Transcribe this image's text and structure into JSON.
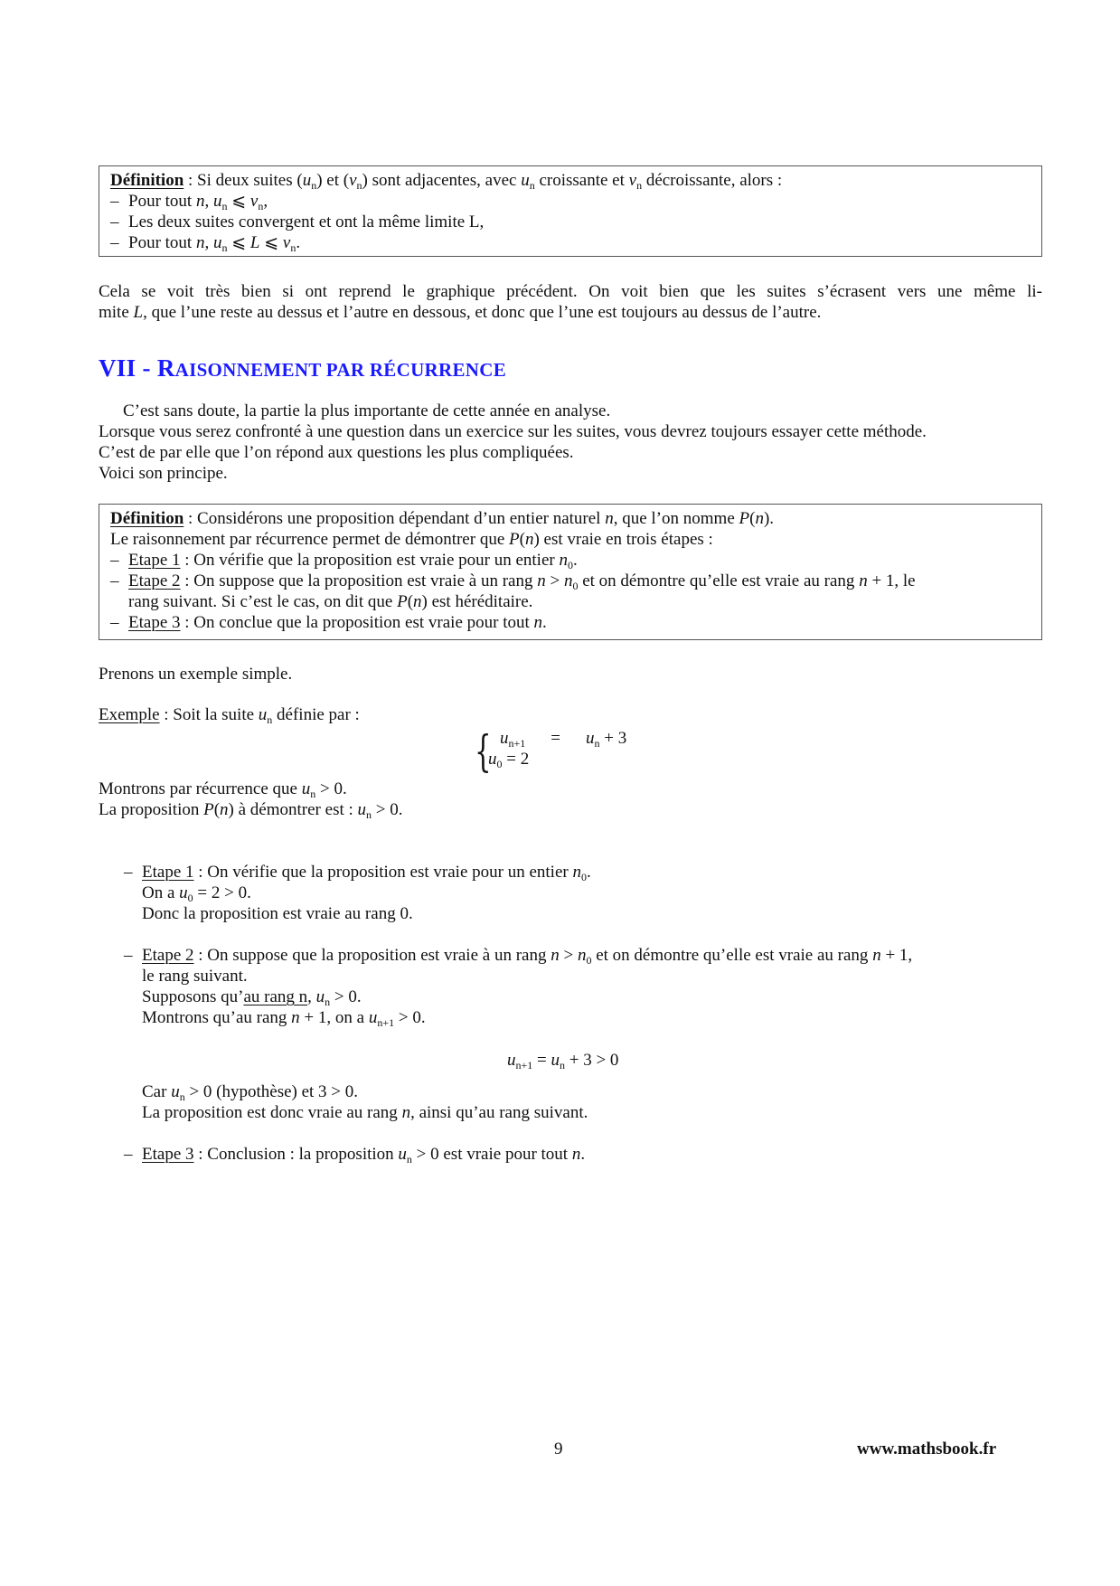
{
  "definition_box_1": {
    "label": "Définition",
    "intro": " : Si deux suites (u",
    "lines": [
      "Pour tout n, un ⩽ vn,",
      "Les deux suites convergent et ont la même limite L,",
      "Pour tout n, un ⩽ L ⩽ vn."
    ],
    "intro_full": "Si deux suites (un) et (vn) sont adjacentes, avec un croissante et vn décroissante, alors :"
  },
  "paragraph_1": {
    "line1": "Cela se voit très bien si ont reprend le graphique précédent. On voit bien que les suites s’écrasent vers une même li-",
    "line2_a": "mite ",
    "line2_b": ", que l’une reste au dessus et l’autre en dessous, et donc que l’une est toujours au dessus de l’autre."
  },
  "section": {
    "number": "VII - ",
    "title_first": "R",
    "title_rest": "AISONNEMENT PAR RÉCURRENCE"
  },
  "intro": {
    "line1": "C’est sans doute, la partie la plus importante de cette année en analyse.",
    "line2": "Lorsque vous serez confronté à une question dans un exercice sur les suites, vous devrez toujours essayer cette méthode.",
    "line3": "C’est de par elle que l’on répond aux questions les plus compliquées.",
    "line4": "Voici son principe."
  },
  "definition_box_2": {
    "label": "Définition",
    "line1_a": " : Considérons une proposition dépendant d’un entier naturel ",
    "line1_b": ", que l’on nomme ",
    "line2_a": "Le raisonnement par récurrence permet de démontrer que ",
    "line2_b": " est vraie en trois étapes :",
    "step1_label": "Etape 1",
    "step1_text": " : On vérifie que la proposition est vraie pour un entier ",
    "step2_label": "Etape 2",
    "step2_text_a": " : On suppose que la proposition est vraie à un rang ",
    "step2_text_b": " et on démontre qu’elle est vraie au rang ",
    "step2_text_c": ", le",
    "step2_line2_a": "rang suivant. Si c’est le cas, on dit que ",
    "step2_line2_b": " est héréditaire.",
    "step3_label": "Etape 3",
    "step3_text": " : On conclue que la proposition est vraie pour tout "
  },
  "example": {
    "lead": "Prenons un exemple simple.",
    "label": "Exemple",
    "text": " : Soit la suite ",
    "text_b": " définie par :",
    "system_row1_rhs": "un + 3",
    "system_row2": "u0 = 2",
    "montrons": "Montrons par récurrence que ",
    "proposition_a": "La proposition ",
    "proposition_b": " à démontrer est : "
  },
  "proof": {
    "step1_label": "Etape 1",
    "step1_text": " : On vérifie que la proposition est vraie pour un entier ",
    "step1_line2": "On a ",
    "step1_line3": "Donc la proposition est vraie au rang 0.",
    "step2_label": "Etape 2",
    "step2_text_a": " : On suppose que la proposition est vraie à un rang ",
    "step2_text_b": " et on démontre qu’elle est vraie au rang ",
    "step2_line2": "le rang suivant.",
    "step2_line3_a": "Supposons qu’",
    "step2_line3_u": "au rang n",
    "step2_line4_a": "Montrons qu’au rang ",
    "step2_line4_b": ", on a ",
    "equation": "un+1 = un + 3 > 0",
    "car": "Car ",
    "car_b": " (hypothèse) et 3 > 0.",
    "conclusion_line": "La proposition est donc vraie au rang ",
    "conclusion_line_b": ", ainsi qu’au rang suivant.",
    "step3_label": "Etape 3",
    "step3_text_a": " : Conclusion : la proposition ",
    "step3_text_b": " est vraie pour tout "
  },
  "footer": {
    "page_number": "9",
    "website": "www.mathsbook.fr"
  }
}
